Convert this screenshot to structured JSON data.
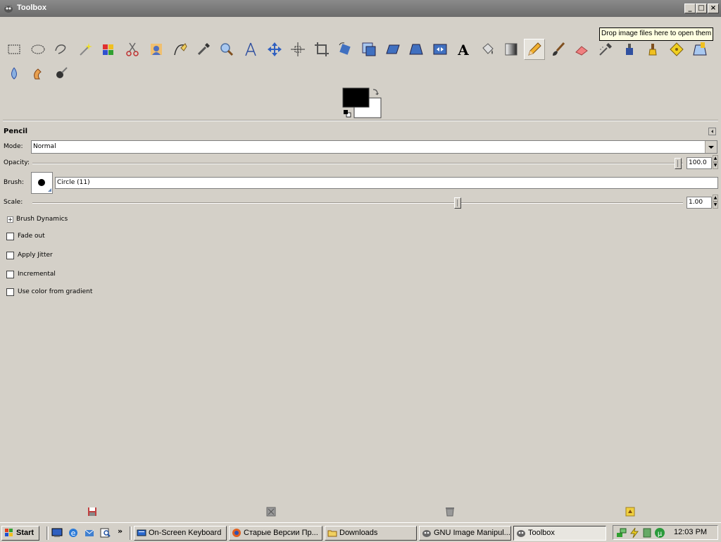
{
  "window": {
    "title": "Toolbox",
    "controls": [
      "_",
      "□",
      "×"
    ]
  },
  "tooltip": "Drop image files here to open them",
  "tools": [
    {
      "icon": "rect-select-icon"
    },
    {
      "icon": "ellipse-select-icon"
    },
    {
      "icon": "free-select-icon"
    },
    {
      "icon": "fuzzy-select-icon"
    },
    {
      "icon": "color-select-icon"
    },
    {
      "icon": "scissors-icon"
    },
    {
      "icon": "foreground-select-icon"
    },
    {
      "icon": "paths-icon"
    },
    {
      "icon": "color-picker-icon"
    },
    {
      "icon": "zoom-icon"
    },
    {
      "icon": "measure-icon"
    },
    {
      "icon": "move-icon"
    },
    {
      "icon": "align-icon"
    },
    {
      "icon": "crop-icon"
    },
    {
      "icon": "rotate-icon"
    },
    {
      "icon": "scale-icon"
    },
    {
      "icon": "shear-icon"
    },
    {
      "icon": "perspective-icon"
    },
    {
      "icon": "flip-icon"
    },
    {
      "icon": "text-icon"
    },
    {
      "icon": "bucket-fill-icon"
    },
    {
      "icon": "blend-icon"
    },
    {
      "icon": "pencil-icon",
      "active": true
    },
    {
      "icon": "paintbrush-icon"
    },
    {
      "icon": "eraser-icon"
    },
    {
      "icon": "airbrush-icon"
    },
    {
      "icon": "ink-icon"
    },
    {
      "icon": "clone-icon"
    },
    {
      "icon": "heal-icon"
    },
    {
      "icon": "perspective-clone-icon"
    },
    {
      "icon": "blur-icon"
    },
    {
      "icon": "smudge-icon"
    },
    {
      "icon": "dodge-burn-icon"
    }
  ],
  "colors": {
    "foreground": "#000000",
    "background": "#ffffff"
  },
  "options": {
    "title": "Pencil",
    "mode_label": "Mode:",
    "mode_value": "Normal",
    "opacity_label": "Opacity:",
    "opacity_value": "100.0",
    "opacity_fraction": 1.0,
    "brush_label": "Brush:",
    "brush_value": "Circle (11)",
    "scale_label": "Scale:",
    "scale_value": "1.00",
    "scale_fraction": 0.66,
    "brush_dynamics_label": "Brush Dynamics",
    "checkboxes": [
      {
        "label": "Fade out",
        "checked": false
      },
      {
        "label": "Apply Jitter",
        "checked": false
      },
      {
        "label": "Incremental",
        "checked": false
      },
      {
        "label": "Use color from gradient",
        "checked": false
      }
    ]
  },
  "bottom_buttons": [
    "save-options-icon",
    "restore-options-icon",
    "delete-options-icon",
    "reset-options-icon"
  ],
  "taskbar": {
    "start_label": "Start",
    "tasks": [
      {
        "label": "On-Screen Keyboard",
        "icon": "keyboard-icon"
      },
      {
        "label": "Старые Версии Пр...",
        "icon": "firefox-icon"
      },
      {
        "label": "Downloads",
        "icon": "folder-icon"
      },
      {
        "label": "GNU Image Manipul...",
        "icon": "gimp-icon"
      },
      {
        "label": "Toolbox",
        "icon": "gimp-icon",
        "pressed": true
      }
    ],
    "chevron": "»",
    "clock": "12:03 PM"
  }
}
